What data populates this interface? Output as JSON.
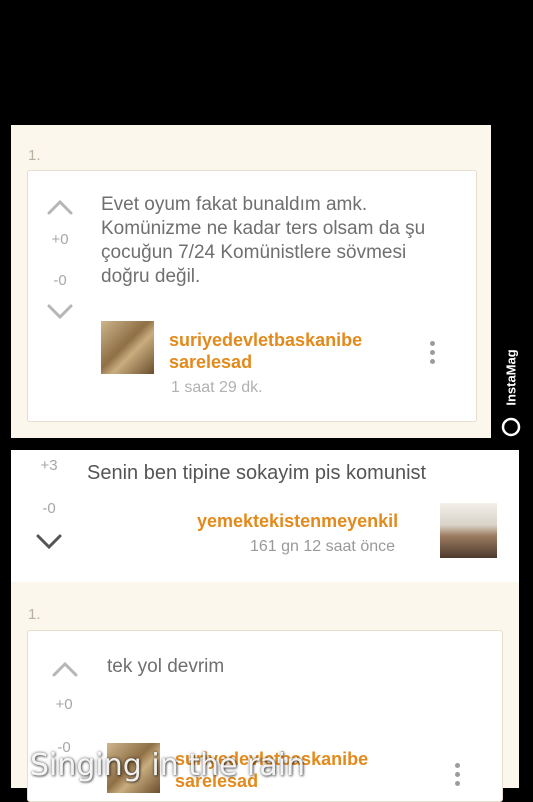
{
  "posts": [
    {
      "index": "1.",
      "upvotes": "+0",
      "downvotes": "-0",
      "text": "Evet oyum fakat bunaldım amk. Komünizme ne kadar ters olsam da şu çocuğun 7/24 Komünistlere sövmesi doğru değil.",
      "username_line1": "suriyedevletbaskanibe",
      "username_line2": "sarelesad",
      "time": "1 saat 29 dk."
    },
    {
      "upvotes": "+3",
      "downvotes": "-0",
      "text": "Senin ben tipine sokayim pis komunist",
      "username": "yemektekistenmeyenkil",
      "time": "161 gn 12 saat  önce"
    },
    {
      "index": "1.",
      "upvotes": "+0",
      "downvotes": "-0",
      "text": "tek yol devrim",
      "username_line1": "suriyedevletbaskanibe",
      "username_line2": "sarelesad"
    }
  ],
  "overlay": {
    "watermark": "InstaMag",
    "caption": "Singing in the rain"
  },
  "icons": {
    "upvote": "chevron-up-icon",
    "downvote": "chevron-down-icon",
    "more": "more-vertical-icon",
    "watermark": "instamag-logo-icon"
  }
}
